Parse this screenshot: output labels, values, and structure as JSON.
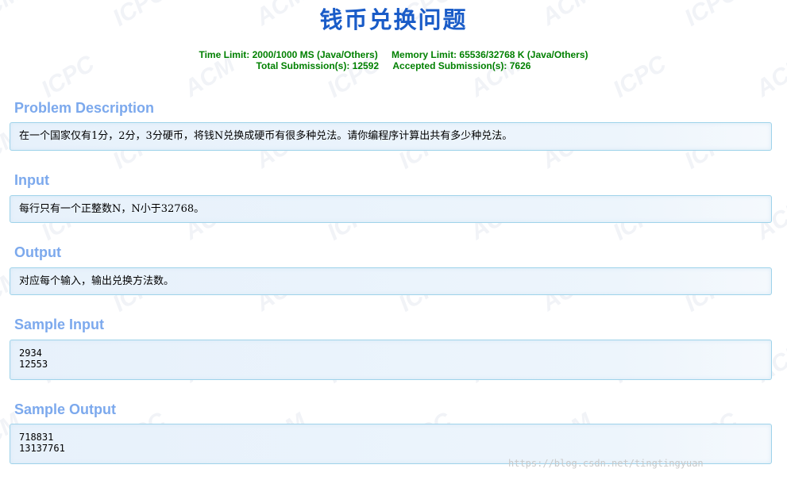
{
  "title": "钱币兑换问题",
  "limits": {
    "time_limit": "Time Limit: 2000/1000 MS (Java/Others)",
    "memory_limit": "Memory Limit: 65536/32768 K (Java/Others)",
    "total_submissions": "Total Submission(s): 12592",
    "accepted_submissions": "Accepted Submission(s): 7626"
  },
  "sections": {
    "description": {
      "heading": "Problem Description",
      "text": "在一个国家仅有1分，2分，3分硬币，将钱N兑换成硬币有很多种兑法。请你编程序计算出共有多少种兑法。"
    },
    "input": {
      "heading": "Input",
      "text": "每行只有一个正整数N，N小于32768。"
    },
    "output": {
      "heading": "Output",
      "text": "对应每个输入，输出兑换方法数。"
    },
    "sample_input": {
      "heading": "Sample Input",
      "lines": [
        "2934",
        "12553"
      ]
    },
    "sample_output": {
      "heading": "Sample Output",
      "lines": [
        "718831",
        "13137761"
      ]
    }
  },
  "watermark": {
    "acm": "ACM",
    "icpc": "ICPC",
    "url": "https://blog.csdn.net/tingtingyuan"
  },
  "colors": {
    "title": "#1a5cc8",
    "limits": "#008000",
    "heading": "#7ca9ed",
    "panel_border": "#9fd3ea",
    "panel_bg": "#e7f1fb"
  }
}
